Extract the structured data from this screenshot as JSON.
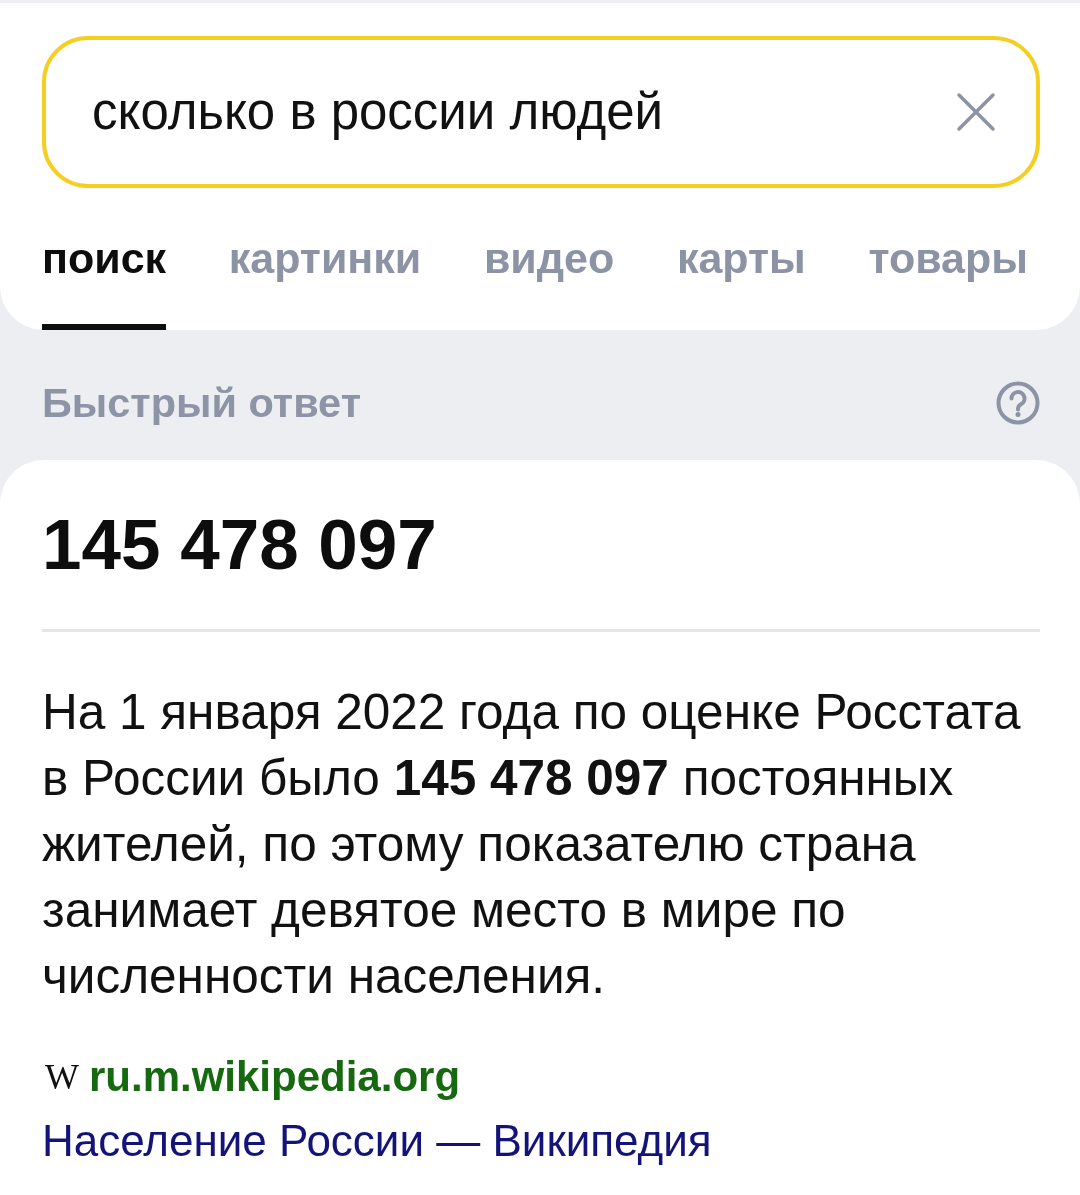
{
  "search": {
    "value": "сколько в россии людей"
  },
  "tabs": [
    {
      "label": "поиск",
      "selected": true
    },
    {
      "label": "картинки",
      "selected": false
    },
    {
      "label": "видео",
      "selected": false
    },
    {
      "label": "карты",
      "selected": false
    },
    {
      "label": "товары",
      "selected": false
    }
  ],
  "quick_answer": {
    "heading": "Быстрый ответ"
  },
  "answer": {
    "value": "145 478 097",
    "text": "На 1 января 2022 года по оценке Росстата в России было **145 478 097** постоянных жителей, по этому показателю страна занимает девятое место в мире по численности населения.",
    "source": {
      "favicon": "W",
      "domain": "ru.m.wikipedia.org",
      "title": "Население России — Википедия"
    }
  }
}
